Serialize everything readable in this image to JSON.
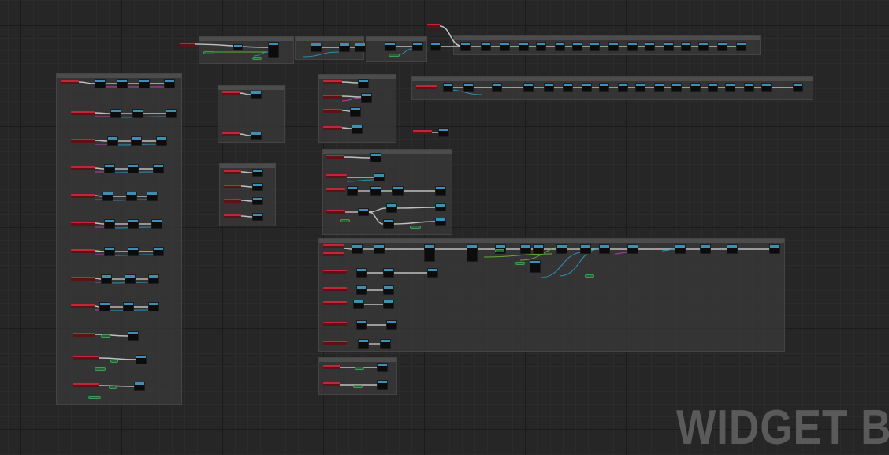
{
  "editor": {
    "view": "event-graph",
    "watermark": "WIDGET BL"
  },
  "colors": {
    "background": "#262626",
    "event_header": "#c0283a",
    "function_header": "#3d8fb5",
    "exec_wire": "#d8d8d8",
    "object_wire": "#2ea0cf",
    "bool_wire": "#8a1a1a",
    "vector_wire": "#c8a62c",
    "struct_wire": "#6fbf3a",
    "string_wire": "#d040c0"
  }
}
